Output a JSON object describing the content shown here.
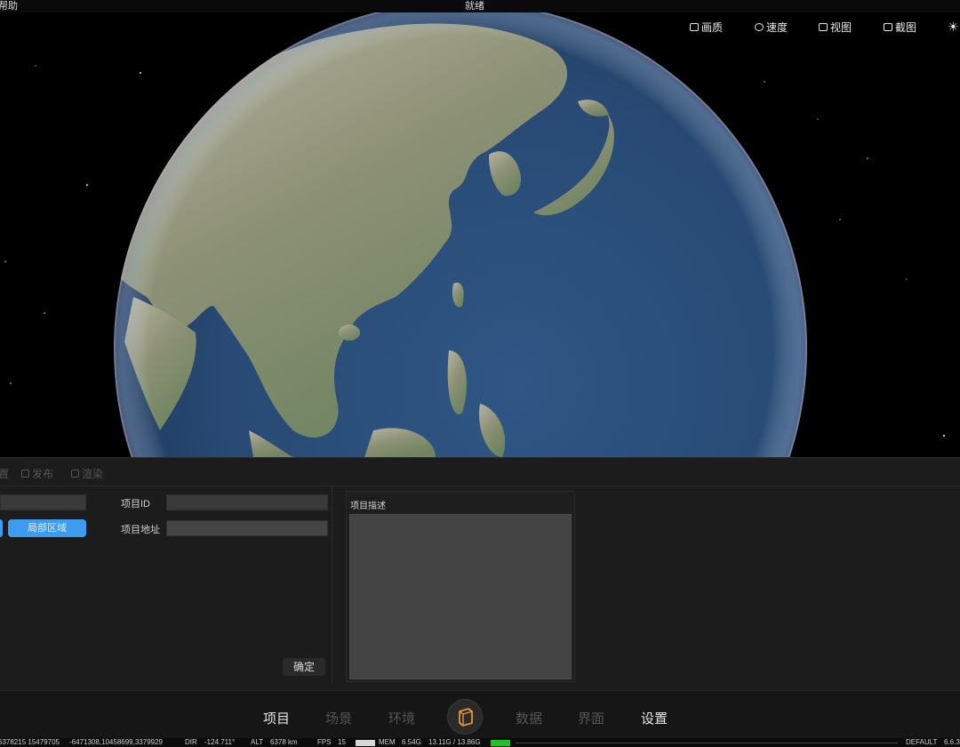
{
  "topbar": {
    "help": "帮助",
    "status": "就绪"
  },
  "toolbar": {
    "items": [
      {
        "label": "画质",
        "icon": "image-icon"
      },
      {
        "label": "速度",
        "icon": "speed-gauge-icon"
      },
      {
        "label": "视图",
        "icon": "video-camera-icon"
      },
      {
        "label": "截图",
        "icon": "screenshot-icon"
      }
    ],
    "extra_icon": "sun-icon"
  },
  "tabs": [
    {
      "label": "置",
      "icon": ""
    },
    {
      "label": "发布",
      "icon": "publish-icon"
    },
    {
      "label": "渲染",
      "icon": "render-icon"
    }
  ],
  "project": {
    "id_label": "项目ID",
    "id_value": "",
    "address_label": "项目地址",
    "address_value": "",
    "area_button": "局部区域",
    "ok_button": "确定",
    "description_label": "项目描述",
    "description_value": ""
  },
  "nav": [
    {
      "label": "项目",
      "active": true
    },
    {
      "label": "场景",
      "active": false
    },
    {
      "label": "环境",
      "active": false
    },
    {
      "label": "数据",
      "active": false
    },
    {
      "label": "界面",
      "active": false
    },
    {
      "label": "设置",
      "active": false
    }
  ],
  "statusbar": {
    "coords": "6378215 15479705",
    "position": "-6471308,10458699,3379929",
    "dir_label": "DIR",
    "dir_value": "-124.711°",
    "alt_label": "ALT",
    "alt_value": "6378 km",
    "fps_label": "FPS",
    "fps_value": "15",
    "mem_label": "MEM",
    "mem_value": "6.54G",
    "mem_total": "13.11G / 13.86G",
    "mode": "DEFAULT",
    "version": "6.6.3"
  },
  "colors": {
    "accent": "#3d9cf0",
    "panel": "#1c1c1c",
    "ocean": "#2f4f7a",
    "mem_bar": "#22c02a"
  }
}
